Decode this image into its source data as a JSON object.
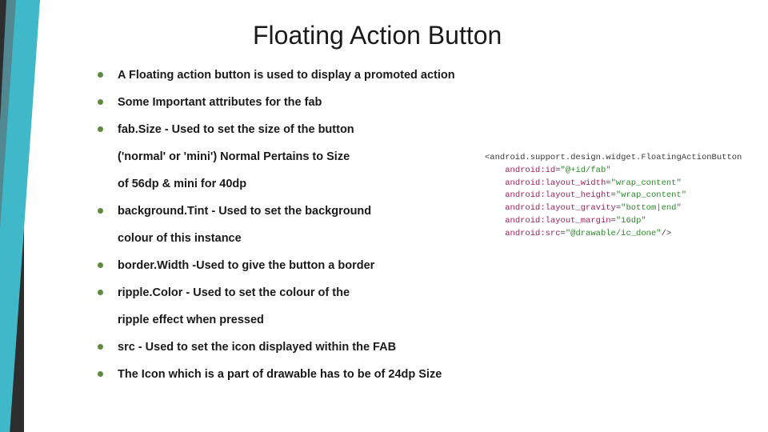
{
  "title": "Floating Action Button",
  "bullets": {
    "b0": "A Floating action button is used to display a promoted action",
    "b1": "Some Important attributes for the fab",
    "b2": "fab.Size - Used to set the size of the button",
    "b2_sub1": "('normal' or 'mini') Normal Pertains to Size",
    "b2_sub2": "of 56dp & mini for 40dp",
    "b3": "background.Tint - Used to set the background",
    "b3_sub1": "colour of this instance",
    "b4": "border.Width -Used to give the button a border",
    "b5": "ripple.Color - Used to set the colour of the",
    "b5_sub1": " ripple effect when pressed",
    "b6": " src - Used to set the icon displayed within the FAB",
    "b7": "The Icon which is a part of drawable has to be of 24dp Size"
  },
  "code": {
    "open_tag": "<android.support.design.widget.FloatingActionButton",
    "attrs": [
      {
        "name": "android:id",
        "value": "\"@+id/fab\""
      },
      {
        "name": "android:layout_width",
        "value": "\"wrap_content\""
      },
      {
        "name": "android:layout_height",
        "value": "\"wrap_content\""
      },
      {
        "name": "android:layout_gravity",
        "value": "\"bottom|end\""
      },
      {
        "name": "android:layout_margin",
        "value": "\"16dp\""
      },
      {
        "name": "android:src",
        "value": "\"@drawable/ic_done\""
      }
    ],
    "close": "/>"
  }
}
